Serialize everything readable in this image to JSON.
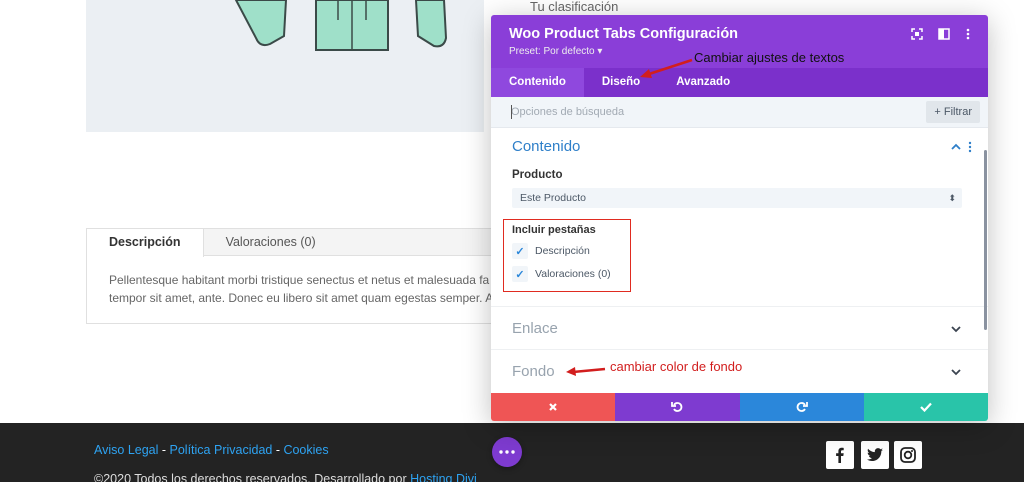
{
  "rating_text": "Tu clasificación",
  "page_tabs": {
    "items": [
      {
        "label": "Descripción"
      },
      {
        "label": "Valoraciones (0)"
      }
    ],
    "body": "Pellentesque habitant morbi tristique senectus et netus et malesuada fa",
    "body2": "tempor sit amet, ante. Donec eu libero sit amet quam egestas semper. A"
  },
  "modal": {
    "title": "Woo Product Tabs Configuración",
    "preset": "Preset: Por defecto ▾",
    "tabs": [
      {
        "label": "Contenido"
      },
      {
        "label": "Diseño"
      },
      {
        "label": "Avanzado"
      }
    ],
    "search_placeholder": "Opciones de búsqueda",
    "filter_label": "+ Filtrar",
    "section_contenido": "Contenido",
    "producto_label": "Producto",
    "producto_value": "Este Producto",
    "incluir_label": "Incluir pestañas",
    "checkboxes": [
      {
        "label": "Descripción"
      },
      {
        "label": "Valoraciones (0)"
      }
    ],
    "section_enlace": "Enlace",
    "section_fondo": "Fondo",
    "footer_colors": {
      "cancel": "#ef5555",
      "undo": "#7e3bd0",
      "redo": "#2b87da",
      "save": "#29c4a9"
    }
  },
  "annotations": {
    "textos": "Cambiar ajustes de textos",
    "fondo": "cambiar color de fondo"
  },
  "footer": {
    "aviso": "Aviso Legal",
    "sep1": " - ",
    "politica": "Política Privacidad",
    "sep2": " - ",
    "cookies": "Cookies",
    "copy_prefix": "©2020 Todos los derechos reservados. Desarrollado por ",
    "copy_link": "Hosting Divi"
  },
  "colors": {
    "accent": "#8a3ed8",
    "link": "#2ea3f2",
    "annotation_red": "#d21e1e"
  }
}
